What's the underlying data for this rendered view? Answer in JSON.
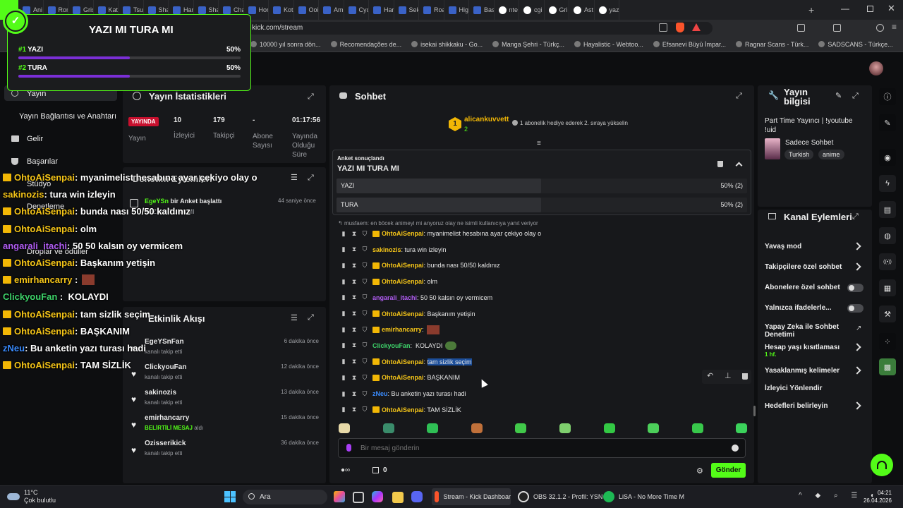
{
  "browser": {
    "tabs": [
      "Ani",
      "Ron",
      "Gris",
      "Kat",
      "Tsu",
      "Sha",
      "Har",
      "Sha",
      "Cha",
      "Hor",
      "Kot",
      "Ooi",
      "Am",
      "Cyc",
      "Har",
      "Sek",
      "Roa",
      "Hig",
      "Bas",
      "nte",
      "cgi",
      "Gri",
      "Ast",
      "yaz"
    ],
    "url": "kick.com/stream",
    "bookmarks": [
      "10000 yıl sonra dön...",
      "Recomendações de...",
      "isekai shikkaku - Go...",
      "Manga Şehri - Türkç...",
      "Hayalistic - Webtoo...",
      "Efsanevi Büyü İmpar...",
      "Ragnar Scans - Türk...",
      "SADSCANS - Türkçe..."
    ]
  },
  "poll_overlay": {
    "title": "YAZI MI TURA MI",
    "options": [
      {
        "rank": "#1",
        "label": "YAZI",
        "percent": "50%",
        "fill": 0.5
      },
      {
        "rank": "#2",
        "label": "TURA",
        "percent": "50%",
        "fill": 0.5
      }
    ]
  },
  "left_nav": {
    "items": [
      "Yayın",
      "Yayın Bağlantısı ve Anahtarı",
      "Gelir",
      "Başarılar",
      "Stüdyo",
      "Denetleme",
      "Droplar ve ödüller"
    ]
  },
  "stats": {
    "title": "Yayın İstatistikleri",
    "live_badge": "YAYINDA",
    "live_label": "Yayın",
    "cols": [
      {
        "value": "10",
        "label": "İzleyici"
      },
      {
        "value": "179",
        "label": "Takipçi"
      },
      {
        "value": "-",
        "label": "Abone Sayısı"
      },
      {
        "value": "01:17:56",
        "label": "Yayında Olduğu Süre"
      }
    ]
  },
  "mod_actions": {
    "title": "Denetim Eylemleri",
    "entry_user": "EgeYSn",
    "entry_text": " bir Anket başlattı",
    "entry_detail": "YAZI MI TURA MI",
    "entry_time": "44 saniye önce"
  },
  "activity": {
    "title": "Etkinlik Akışı",
    "items": [
      {
        "name": "EgeYSnFan",
        "desc": "kanalı takip etti",
        "time": "6 dakika önce"
      },
      {
        "name": "ClickyouFan",
        "desc": "kanalı takip etti",
        "time": "12 dakika önce"
      },
      {
        "name": "sakinozis",
        "desc": "kanalı takip etti",
        "time": "13 dakika önce"
      },
      {
        "name": "emirhancarry",
        "desc_highlight": "BELİRTİLİ MESAJ",
        "desc": " aldı",
        "time": "15 dakika önce"
      },
      {
        "name": "Ozisserikick",
        "desc": "kanalı takip etti",
        "time": "36 dakika önce"
      }
    ]
  },
  "overlay_chat": [
    {
      "user": "OhtoAiSenpai",
      "color": "#f5c518",
      "crown": true,
      "text": ": myanimelist hesabına ayar çekiyo olay o"
    },
    {
      "user": "sakinozis",
      "color": "#f5c518",
      "crown": false,
      "text": ": tura win izleyin"
    },
    {
      "user": "OhtoAiSenpai",
      "color": "#f5c518",
      "crown": true,
      "text": ": bunda nası 50/50 kaldınız"
    },
    {
      "user": "OhtoAiSenpai",
      "color": "#f5c518",
      "crown": true,
      "text": ": olm"
    },
    {
      "user": "angarali_itachi",
      "color": "#b05cf2",
      "crown": false,
      "text": ": 50 50 kalsın oy vermicem"
    },
    {
      "user": "OhtoAiSenpai",
      "color": "#f5c518",
      "crown": true,
      "text": ": Başkanım yetişin"
    },
    {
      "user": "emirhancarry",
      "color": "#f5c518",
      "crown": true,
      "text": " :"
    },
    {
      "user": "ClickyouFan",
      "color": "#3ed36a",
      "crown": false,
      "text": " :  KOLAYDI"
    },
    {
      "user": "OhtoAiSenpai",
      "color": "#f5c518",
      "crown": true,
      "text": ": tam sizlik seçim"
    },
    {
      "user": "OhtoAiSenpai",
      "color": "#f5c518",
      "crown": true,
      "text": ": BAŞKANIM"
    },
    {
      "user": "zNeu",
      "color": "#3a8cff",
      "crown": false,
      "text": ": Bu anketin yazı turası hadi"
    },
    {
      "user": "OhtoAiSenpai",
      "color": "#f5c518",
      "crown": true,
      "text": ": TAM SİZLİK"
    }
  ],
  "chat": {
    "title": "Sohbet",
    "gift_rank": "1",
    "gift_user": "alicankuvvett",
    "gift_count": "2",
    "gift_text": "1 abonelik hediye ederek 2. sıraya yükselin",
    "poll": {
      "status": "Anket sonuçlandı",
      "question": "YAZI MI TURA MI",
      "options": [
        {
          "label": "YAZI",
          "result": "50% (2)",
          "fill": 0.5
        },
        {
          "label": "TURA",
          "result": "50% (2)",
          "fill": 0.5
        }
      ]
    },
    "reply_hint": "musfaem: en böcek animeyi mi anyoruz olay ne isimli kullanıcıya yanıt veriyor",
    "messages": [
      {
        "user": "OhtoAiSenpai",
        "color": "#f5c518",
        "crown": true,
        "text": ": myanimelist hesabına ayar çekiyo olay o"
      },
      {
        "user": "sakinozis",
        "color": "#f5c518",
        "crown": false,
        "text": ": tura win izleyin"
      },
      {
        "user": "OhtoAiSenpai",
        "color": "#f5c518",
        "crown": true,
        "text": ": bunda nası 50/50 kaldınız"
      },
      {
        "user": "OhtoAiSenpai",
        "color": "#f5c518",
        "crown": true,
        "text": ": olm"
      },
      {
        "user": "angarali_itachi",
        "color": "#b05cf2",
        "crown": false,
        "text": ": 50 50 kalsın oy vermicem"
      },
      {
        "user": "OhtoAiSenpai",
        "color": "#f5c518",
        "crown": true,
        "text": ": Başkanım yetişin"
      },
      {
        "user": "emirhancarry",
        "color": "#f5c518",
        "crown": true,
        "text": ":"
      },
      {
        "user": "ClickyouFan",
        "color": "#3ed36a",
        "crown": false,
        "text": ":  KOLAYDI"
      },
      {
        "user": "OhtoAiSenpai",
        "color": "#f5c518",
        "crown": true,
        "text": ": ",
        "highlight": "tam sizlik seçim"
      },
      {
        "user": "OhtoAiSenpai",
        "color": "#f5c518",
        "crown": true,
        "text": ": BAŞKANIM"
      },
      {
        "user": "zNeu",
        "color": "#3a8cff",
        "crown": false,
        "text": ": Bu anketin yazı turası hadi"
      },
      {
        "user": "OhtoAiSenpai",
        "color": "#f5c518",
        "crown": true,
        "text": ": TAM SİZLİK"
      }
    ],
    "input_placeholder": "Bir mesaj gönderin",
    "points": "0",
    "send_label": "Gönder"
  },
  "stream_info": {
    "title": "Yayın bilgisi",
    "stream_title": "Part Time Yayıncı | !youtube !uid",
    "category": "Sadece Sohbet",
    "tags": [
      "Turkish",
      "anime"
    ]
  },
  "channel_actions": {
    "title": "Kanal Eylemleri",
    "items": [
      {
        "label": "Yavaş mod",
        "control": "chevron"
      },
      {
        "label": "Takipçilere özel sohbet",
        "control": "chevron"
      },
      {
        "label": "Abonelere özel sohbet",
        "control": "toggle"
      },
      {
        "label": "Yalnızca ifadelerle...",
        "control": "toggle"
      },
      {
        "label": "Yapay Zeka ile Sohbet Denetimi",
        "control": "link"
      },
      {
        "label": "Hesap yaşı kısıtlaması",
        "sub": "1 hf.",
        "control": "chevron"
      },
      {
        "label": "Yasaklanmış kelimeler",
        "control": "chevron"
      },
      {
        "label": "İzleyici Yönlendir",
        "control": "none"
      },
      {
        "label": "Hedefleri belirleyin",
        "control": "chevron"
      }
    ]
  },
  "taskbar": {
    "weather_temp": "11°C",
    "weather_desc": "Çok bulutlu",
    "search_placeholder": "Ara",
    "apps": [
      {
        "label": "Stream - Kick Dashboar"
      },
      {
        "label": "OBS 32.1.2 - Profil: YSN"
      },
      {
        "label": "LiSA - No More Time M"
      }
    ],
    "time": "04:21",
    "date": "26.04.2026"
  },
  "colors": {
    "accent": "#53fc18",
    "poll": "#7b2fd6",
    "mod_yellow": "#f5c518"
  }
}
